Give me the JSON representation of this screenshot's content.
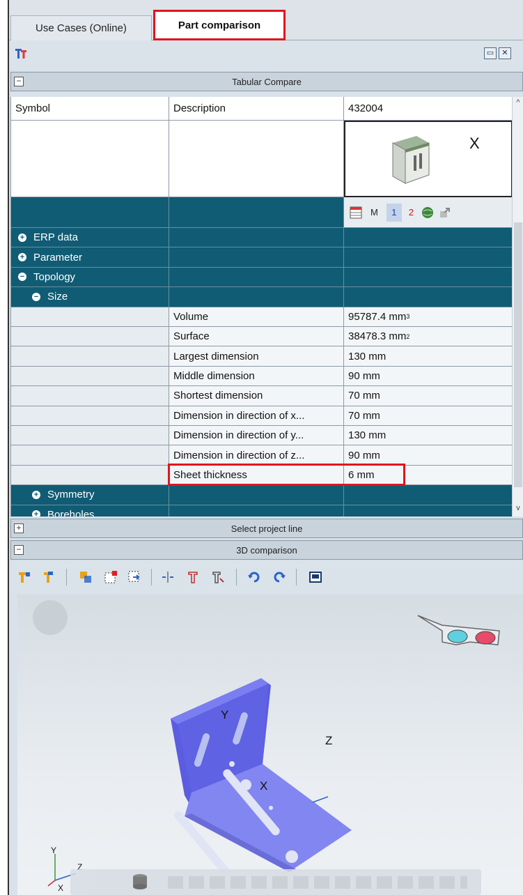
{
  "tabs": [
    {
      "label": "Use Cases (Online)"
    },
    {
      "label": "Part comparison"
    }
  ],
  "groups": {
    "tabular_compare": "Tabular Compare",
    "select_project_line": "Select project line",
    "comparison_3d": "3D comparison"
  },
  "table": {
    "headers": [
      "Symbol",
      "Description",
      "432004"
    ],
    "preview_close": "X",
    "toolbar_labels": {
      "m": "M",
      "one": "1",
      "two": "2"
    },
    "rows": [
      {
        "label": "ERP data",
        "type": "group",
        "level": 0,
        "expander": "plus"
      },
      {
        "label": "Parameter",
        "type": "group",
        "level": 0,
        "expander": "plus"
      },
      {
        "label": "Topology",
        "type": "group",
        "level": 0,
        "expander": "minus"
      },
      {
        "label": "Size",
        "type": "group",
        "level": 1,
        "expander": "minus"
      },
      {
        "label": "Volume",
        "value": "95787.4 mm",
        "unit_sup": "3",
        "type": "data"
      },
      {
        "label": "Surface",
        "value": "38478.3 mm",
        "unit_sup": "2",
        "type": "data"
      },
      {
        "label": "Largest dimension",
        "value": "130 mm",
        "type": "data"
      },
      {
        "label": "Middle dimension",
        "value": "90 mm",
        "type": "data"
      },
      {
        "label": "Shortest dimension",
        "value": "70 mm",
        "type": "data"
      },
      {
        "label": "Dimension in direction of x...",
        "value": "70 mm",
        "type": "data"
      },
      {
        "label": "Dimension in direction of y...",
        "value": "130 mm",
        "type": "data"
      },
      {
        "label": "Dimension in direction of z...",
        "value": "90 mm",
        "type": "data"
      },
      {
        "label": "Sheet thickness",
        "value": "6 mm",
        "type": "data"
      },
      {
        "label": "Symmetry",
        "type": "group",
        "level": 1,
        "expander": "plus"
      },
      {
        "label": "Boreholes",
        "type": "group",
        "level": 1,
        "expander": "plus"
      }
    ]
  },
  "viewport": {
    "axis_labels": {
      "y": "Y",
      "z": "Z",
      "x": "X"
    },
    "triad": {
      "y": "Y",
      "z": "Z",
      "x": "X"
    }
  },
  "colors": {
    "accent_red": "#e0141e",
    "tree_dark": "#105c74",
    "part_blue": "#6f72e6"
  }
}
